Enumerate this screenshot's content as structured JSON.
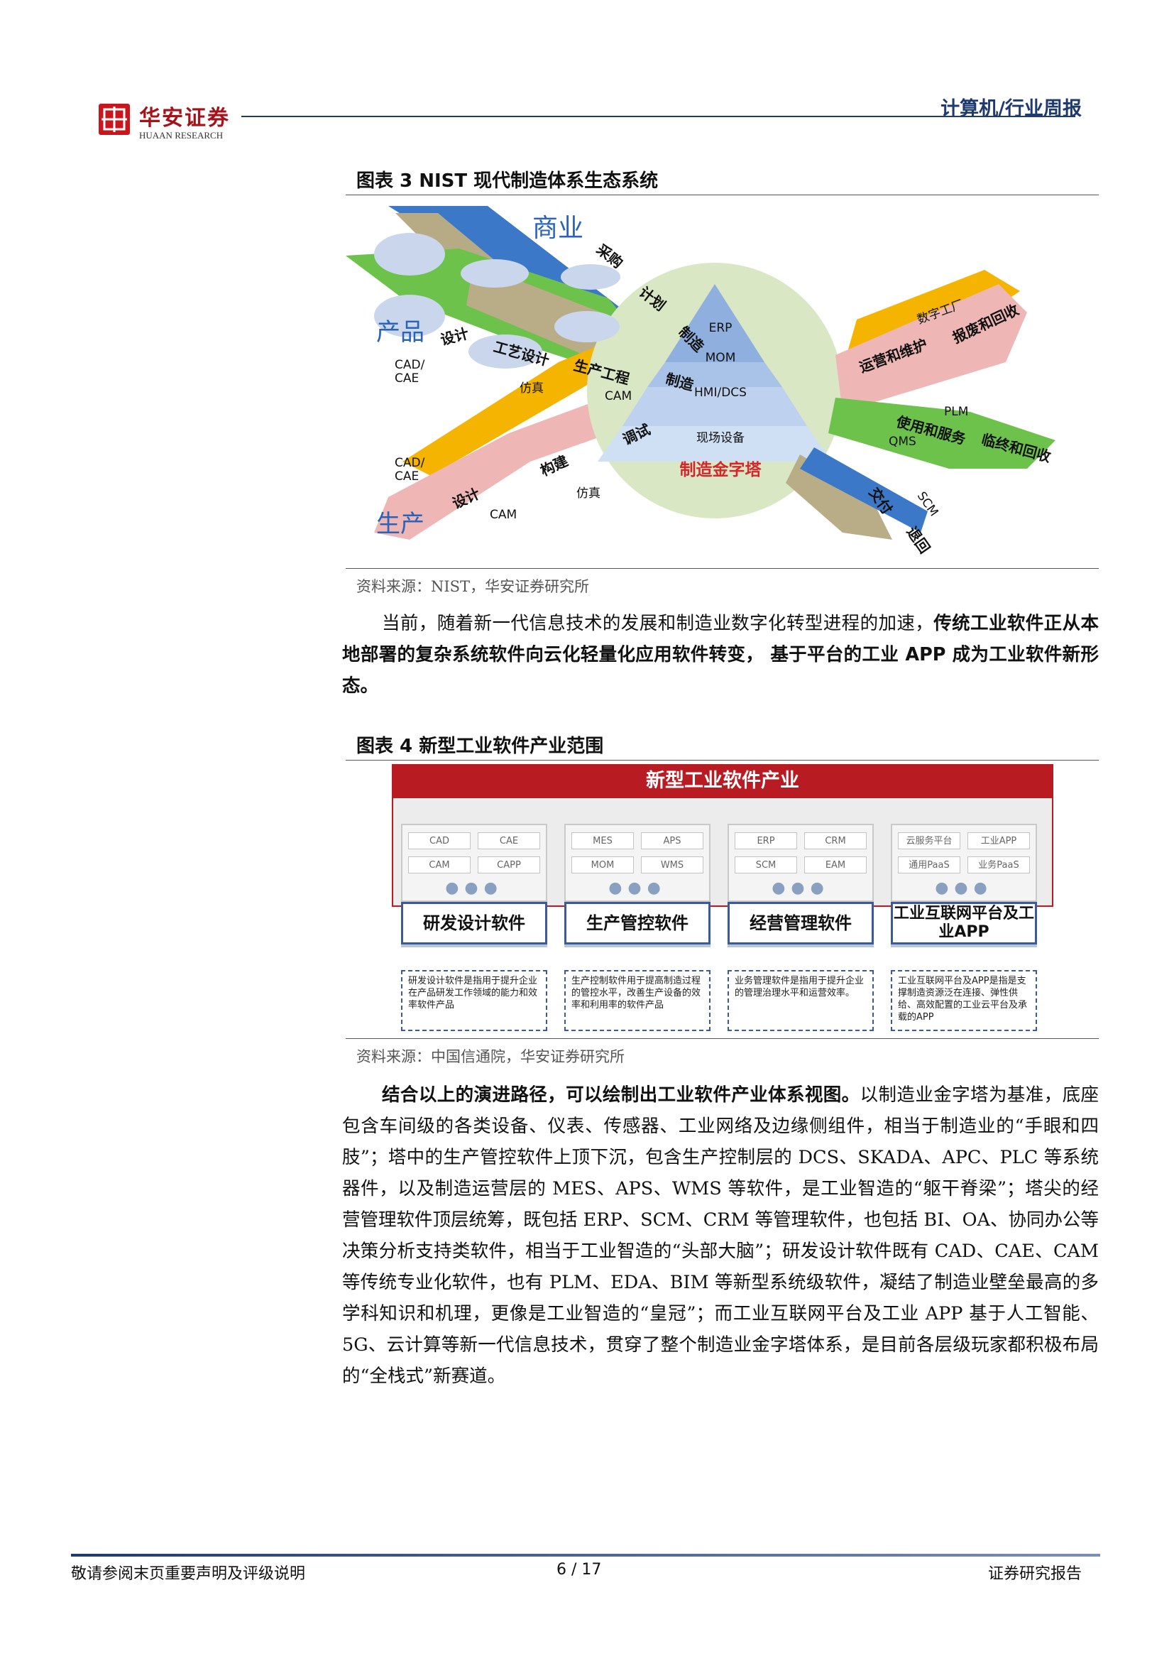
{
  "header": {
    "logo_cn": "华安证券",
    "logo_en": "HUAAN RESEARCH",
    "section": "计算机/行业周报"
  },
  "figure3": {
    "title": "图表 3 NIST 现代制造体系生态系统",
    "branch_labels": {
      "business": "商业",
      "product": "产品",
      "production": "生产"
    },
    "stage_labels": {
      "b1": "采购",
      "b2": "计划",
      "b3": "制造",
      "p1": "设计",
      "p2": "工艺设计",
      "p3": "生产工程",
      "p4": "制造",
      "s1": "设计",
      "s2": "构建",
      "s3": "调试",
      "r1": "数字工厂",
      "r2": "运营和维护",
      "r3": "报废和回收",
      "r4": "使用和服务",
      "r5": "临终和回收",
      "r6": "交付",
      "r7": "退回"
    },
    "bubbles": {
      "cad_cae_1": "CAD/\nCAE",
      "sim1": "仿真",
      "cam1": "CAM",
      "cad_cae_2": "CAD/\nCAE",
      "sim2": "仿真",
      "cam2": "CAM",
      "plm": "PLM",
      "qms": "QMS",
      "scm": "SCM"
    },
    "pyramid": {
      "l1": "ERP",
      "l2": "MOM",
      "l3": "HMI/DCS",
      "l4": "现场设备",
      "caption": "制造金字塔"
    },
    "source": "资料来源：NIST，华安证券研究所"
  },
  "paragraph1": {
    "normal": "当前，随着新一代信息技术的发展和制造业数字化转型进程的加速，",
    "bold": "传统工业软件正从本地部署的复杂系统软件向云化轻量化应用软件转变， 基于平台的工业 APP 成为工业软件新形态。"
  },
  "figure4": {
    "title": "图表 4 新型工业软件产业范围",
    "banner": "新型工业软件产业",
    "groups": [
      {
        "cells": [
          "CAD",
          "CAE",
          "CAM",
          "CAPP"
        ],
        "category": "研发设计软件",
        "desc": "研发设计软件是指用于提升企业在产品研发工作领域的能力和效率软件产品"
      },
      {
        "cells": [
          "MES",
          "APS",
          "MOM",
          "WMS"
        ],
        "category": "生产管控软件",
        "desc": "生产控制软件用于提高制造过程的管控水平，改善生产设备的效率和利用率的软件产品"
      },
      {
        "cells": [
          "ERP",
          "CRM",
          "SCM",
          "EAM"
        ],
        "category": "经营管理软件",
        "desc": "业务管理软件是指用于提升企业的管理治理水平和运营效率。"
      },
      {
        "cells": [
          "云服务平台",
          "工业APP",
          "通用PaaS",
          "业务PaaS"
        ],
        "category": "工业互联网平台及工业APP",
        "desc": "工业互联网平台及APP是指是支撑制造资源泛在连接、弹性供给、高效配置的工业云平台及承载的APP"
      }
    ],
    "dots": "●●●",
    "source": "资料来源：中国信通院，华安证券研究所"
  },
  "paragraph2": {
    "bold": "结合以上的演进路径，可以绘制出工业软件产业体系视图。",
    "normal": "以制造业金字塔为基准，底座包含车间级的各类设备、仪表、传感器、工业网络及边缘侧组件，相当于制造业的“手眼和四肢”；塔中的生产管控软件上顶下沉，包含生产控制层的 DCS、SKADA、APC、PLC 等系统器件，以及制造运营层的 MES、APS、WMS 等软件，是工业智造的“躯干脊梁”；塔尖的经营管理软件顶层统筹，既包括 ERP、SCM、CRM 等管理软件，也包括 BI、OA、协同办公等决策分析支持类软件，相当于工业智造的“头部大脑”；研发设计软件既有 CAD、CAE、CAM 等传统专业化软件，也有 PLM、EDA、BIM 等新型系统级软件，凝结了制造业壁垒最高的多学科知识和机理，更像是工业智造的“皇冠”；而工业互联网平台及工业 APP 基于人工智能、5G、云计算等新一代信息技术，贯穿了整个制造业金字塔体系，是目前各层级玩家都积极布局的“全栈式”新赛道。"
  },
  "footer": {
    "left": "敬请参阅末页重要声明及评级说明",
    "page": "6 / 17",
    "right": "证券研究报告"
  }
}
